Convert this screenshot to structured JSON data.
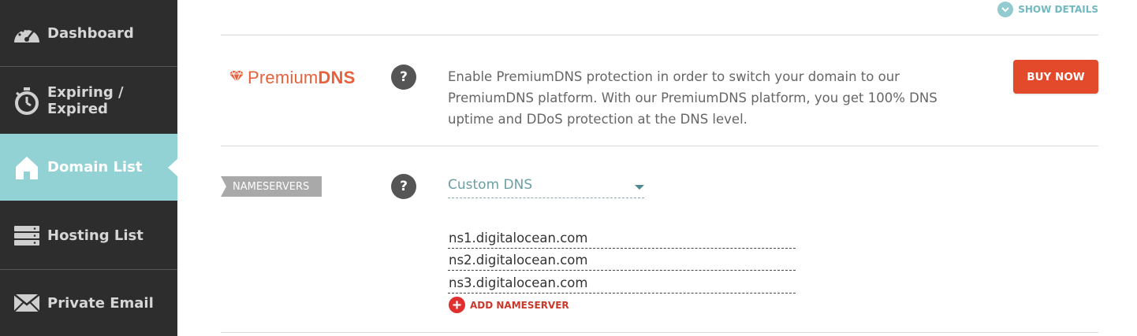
{
  "sidebar": {
    "items": [
      {
        "label": "Dashboard",
        "icon": "speedometer-icon",
        "active": false
      },
      {
        "label": "Expiring / Expired",
        "icon": "stopwatch-icon",
        "active": false
      },
      {
        "label": "Domain List",
        "icon": "home-icon",
        "active": true
      },
      {
        "label": "Hosting List",
        "icon": "server-icon",
        "active": false
      },
      {
        "label": "Private Email",
        "icon": "envelope-icon",
        "active": false
      }
    ]
  },
  "header": {
    "show_details_label": "SHOW DETAILS"
  },
  "premium_dns": {
    "logo_text_light": "Premium",
    "logo_text_bold": "DNS",
    "help_label": "?",
    "description": "Enable PremiumDNS protection in order to switch your domain to our PremiumDNS platform. With our PremiumDNS platform, you get 100% DNS uptime and DDoS protection at the DNS level.",
    "buy_label": "BUY NOW"
  },
  "nameservers": {
    "tag_label": "NAMESERVERS",
    "help_label": "?",
    "selected_option": "Custom DNS",
    "entries": [
      "ns1.digitalocean.com",
      "ns2.digitalocean.com",
      "ns3.digitalocean.com"
    ],
    "add_label": "ADD NAMESERVER"
  },
  "colors": {
    "sidebar_bg": "#2d2d2d",
    "active_bg": "#93d2d4",
    "brand_orange": "#e8603c",
    "buy_button": "#e24a2b",
    "accent_teal": "#6fb9bf"
  }
}
